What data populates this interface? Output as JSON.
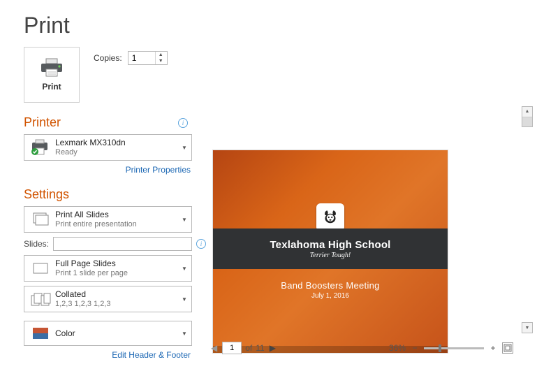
{
  "title": "Print",
  "printBtnLabel": "Print",
  "copies": {
    "label": "Copies:",
    "value": "1"
  },
  "sections": {
    "printer": {
      "title": "Printer",
      "link": "Printer Properties"
    },
    "settings": {
      "title": "Settings",
      "editHeaderFooter": "Edit Header & Footer"
    }
  },
  "printer": {
    "name": "Lexmark MX310dn",
    "status": "Ready"
  },
  "settings": {
    "slidesRange": {
      "main": "Print All Slides",
      "sub": "Print entire presentation"
    },
    "slidesLabel": "Slides:",
    "slidesValue": "",
    "layout": {
      "main": "Full Page Slides",
      "sub": "Print 1 slide per page"
    },
    "collate": {
      "main": "Collated",
      "sub": "1,2,3    1,2,3    1,2,3"
    },
    "color": {
      "main": "Color"
    }
  },
  "preview": {
    "school": "Texlahoma High School",
    "tagline": "Terrier Tough!",
    "event": "Band Boosters Meeting",
    "date": "July 1, 2016"
  },
  "pager": {
    "current": "1",
    "ofLabel": "of",
    "total": "11"
  },
  "zoom": {
    "percent": "36%"
  }
}
